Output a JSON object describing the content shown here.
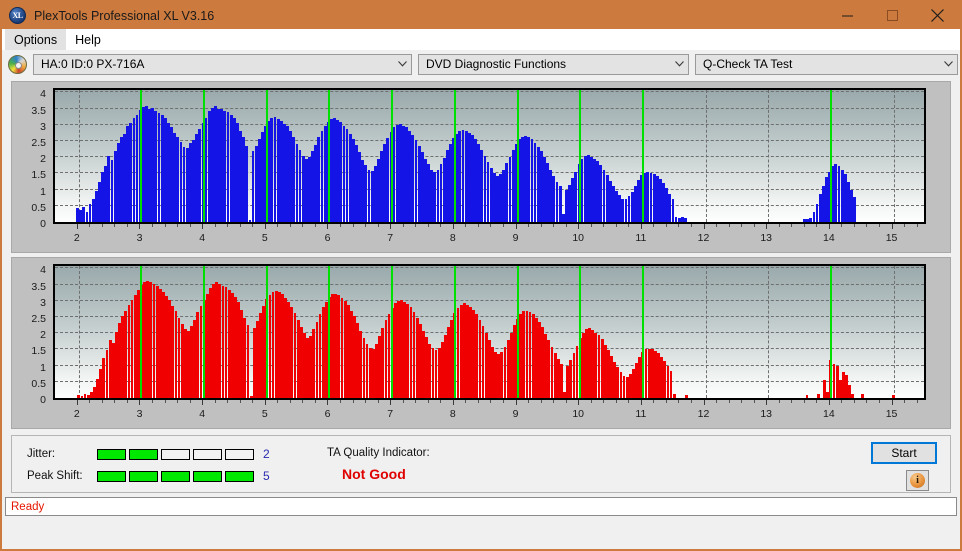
{
  "window": {
    "title": "PlexTools Professional XL V3.16",
    "app_icon": "XL",
    "minimize": "minimize-icon",
    "maximize": "maximize-icon",
    "close": "close-icon",
    "titlebar_color": "#cc7a3d"
  },
  "menubar": {
    "items": [
      {
        "label": "Options"
      },
      {
        "label": "Help"
      }
    ]
  },
  "toolbar": {
    "drive_select": "HA:0 ID:0  PX-716A",
    "function_select": "DVD Diagnostic Functions",
    "test_select": "Q-Check TA Test"
  },
  "results": {
    "jitter_label": "Jitter:",
    "jitter_value": "2",
    "jitter_filled": 2,
    "jitter_total": 5,
    "peak_shift_label": "Peak Shift:",
    "peak_shift_value": "5",
    "peak_shift_filled": 5,
    "peak_shift_total": 5,
    "ta_quality_label": "TA Quality Indicator:",
    "ta_quality_value": "Not Good",
    "ta_quality_color": "#e00000",
    "start_label": "Start",
    "info_label": "i"
  },
  "statusbar": {
    "text": "Ready",
    "color": "#e51400"
  },
  "chart_data": [
    {
      "type": "bar",
      "title": "",
      "name": "ta-test-chart-blue",
      "color": "#1414e6",
      "xlabel": "",
      "ylabel": "",
      "xlim": [
        1.62,
        15.55
      ],
      "ylim": [
        0,
        4.2
      ],
      "yticks": [
        0,
        0.5,
        1,
        1.5,
        2,
        2.5,
        3,
        3.5,
        4
      ],
      "xticks": [
        2,
        3,
        4,
        5,
        6,
        7,
        8,
        9,
        10,
        11,
        12,
        13,
        14,
        15
      ],
      "grid": true,
      "markers": [
        3,
        4,
        5,
        6,
        7,
        8,
        9,
        10,
        11,
        14
      ],
      "marker_color": "#00e000",
      "x": [
        1.98,
        2.03,
        2.08,
        2.13,
        2.18,
        2.23,
        2.28,
        2.33,
        2.38,
        2.43,
        2.48,
        2.53,
        2.58,
        2.63,
        2.68,
        2.73,
        2.78,
        2.83,
        2.88,
        2.93,
        2.98,
        3.03,
        3.08,
        3.13,
        3.18,
        3.23,
        3.28,
        3.33,
        3.38,
        3.43,
        3.48,
        3.53,
        3.58,
        3.63,
        3.68,
        3.73,
        3.78,
        3.83,
        3.88,
        3.93,
        3.98,
        4.03,
        4.08,
        4.13,
        4.18,
        4.23,
        4.28,
        4.33,
        4.38,
        4.43,
        4.48,
        4.53,
        4.58,
        4.63,
        4.68,
        4.73,
        4.78,
        4.83,
        4.88,
        4.93,
        4.98,
        5.03,
        5.08,
        5.13,
        5.18,
        5.23,
        5.28,
        5.33,
        5.38,
        5.43,
        5.48,
        5.53,
        5.58,
        5.63,
        5.68,
        5.73,
        5.78,
        5.83,
        5.88,
        5.93,
        5.98,
        6.03,
        6.08,
        6.13,
        6.18,
        6.23,
        6.28,
        6.33,
        6.38,
        6.43,
        6.48,
        6.53,
        6.58,
        6.63,
        6.68,
        6.73,
        6.78,
        6.83,
        6.88,
        6.93,
        6.98,
        7.03,
        7.08,
        7.13,
        7.18,
        7.23,
        7.28,
        7.33,
        7.38,
        7.43,
        7.48,
        7.53,
        7.58,
        7.63,
        7.68,
        7.73,
        7.78,
        7.83,
        7.88,
        7.93,
        7.98,
        8.03,
        8.08,
        8.13,
        8.18,
        8.23,
        8.28,
        8.33,
        8.38,
        8.43,
        8.48,
        8.53,
        8.58,
        8.63,
        8.68,
        8.73,
        8.78,
        8.83,
        8.88,
        8.93,
        8.98,
        9.03,
        9.08,
        9.13,
        9.18,
        9.23,
        9.28,
        9.33,
        9.38,
        9.43,
        9.48,
        9.53,
        9.58,
        9.63,
        9.68,
        9.73,
        9.78,
        9.83,
        9.88,
        9.93,
        9.98,
        10.03,
        10.08,
        10.13,
        10.18,
        10.23,
        10.28,
        10.33,
        10.38,
        10.43,
        10.48,
        10.53,
        10.58,
        10.63,
        10.68,
        10.73,
        10.78,
        10.83,
        10.88,
        10.93,
        10.98,
        11.03,
        11.08,
        11.13,
        11.18,
        11.23,
        11.28,
        11.33,
        11.38,
        11.43,
        11.48,
        11.53,
        11.58,
        11.63,
        11.68,
        13.58,
        13.63,
        13.68,
        13.73,
        13.78,
        13.83,
        13.88,
        13.93,
        13.98,
        14.03,
        14.08,
        14.13,
        14.18,
        14.23,
        14.28,
        14.33,
        14.38
      ],
      "values": [
        0.42,
        0.38,
        0.45,
        0.3,
        0.55,
        0.72,
        0.95,
        1.25,
        1.55,
        1.72,
        2.05,
        1.9,
        2.2,
        2.45,
        2.62,
        2.72,
        2.95,
        3.05,
        3.22,
        3.32,
        3.45,
        3.55,
        3.58,
        3.5,
        3.52,
        3.42,
        3.38,
        3.3,
        3.22,
        3.05,
        2.92,
        2.75,
        2.62,
        2.48,
        2.32,
        2.3,
        2.45,
        2.52,
        2.72,
        2.88,
        3.05,
        3.2,
        3.42,
        3.52,
        3.58,
        3.5,
        3.48,
        3.42,
        3.4,
        3.3,
        3.22,
        3.05,
        2.82,
        2.62,
        2.35,
        0.05,
        2.18,
        2.35,
        2.55,
        2.78,
        2.95,
        3.12,
        3.22,
        3.25,
        3.18,
        3.12,
        3.02,
        2.95,
        2.82,
        2.62,
        2.42,
        2.22,
        2.05,
        1.95,
        2.02,
        2.18,
        2.38,
        2.62,
        2.82,
        2.98,
        3.1,
        3.18,
        3.2,
        3.15,
        3.08,
        2.98,
        2.88,
        2.72,
        2.55,
        2.38,
        2.15,
        1.92,
        1.75,
        1.62,
        1.58,
        1.72,
        1.95,
        2.18,
        2.42,
        2.58,
        2.78,
        2.92,
        3.0,
        3.02,
        2.98,
        2.92,
        2.82,
        2.7,
        2.52,
        2.35,
        2.15,
        1.95,
        1.78,
        1.62,
        1.55,
        1.6,
        1.78,
        1.98,
        2.22,
        2.42,
        2.6,
        2.72,
        2.82,
        2.85,
        2.82,
        2.75,
        2.68,
        2.55,
        2.4,
        2.22,
        2.05,
        1.85,
        1.68,
        1.5,
        1.42,
        1.48,
        1.62,
        1.82,
        2.02,
        2.22,
        2.4,
        2.55,
        2.62,
        2.65,
        2.62,
        2.55,
        2.45,
        2.32,
        2.18,
        2.0,
        1.82,
        1.62,
        1.42,
        1.25,
        1.1,
        0.25,
        1.0,
        1.15,
        1.35,
        1.55,
        1.78,
        1.95,
        2.05,
        2.08,
        2.02,
        1.95,
        1.88,
        1.75,
        1.6,
        1.45,
        1.28,
        1.12,
        0.95,
        0.82,
        0.72,
        0.7,
        0.8,
        0.92,
        1.12,
        1.3,
        1.45,
        1.52,
        1.55,
        1.52,
        1.48,
        1.42,
        1.32,
        1.2,
        1.05,
        0.88,
        0.7,
        0.15,
        0.12,
        0.14,
        0.12,
        0.08,
        0.1,
        0.12,
        0.3,
        0.55,
        0.85,
        1.12,
        1.38,
        1.55,
        1.72,
        1.78,
        1.72,
        1.62,
        1.48,
        1.25,
        1.0,
        0.78
      ]
    },
    {
      "type": "bar",
      "title": "",
      "name": "ta-test-chart-red",
      "color": "#f00000",
      "xlabel": "",
      "ylabel": "",
      "xlim": [
        1.62,
        15.55
      ],
      "ylim": [
        0,
        4.2
      ],
      "yticks": [
        0,
        0.5,
        1,
        1.5,
        2,
        2.5,
        3,
        3.5,
        4
      ],
      "xticks": [
        2,
        3,
        4,
        5,
        6,
        7,
        8,
        9,
        10,
        11,
        12,
        13,
        14,
        15
      ],
      "grid": true,
      "markers": [
        3,
        4,
        5,
        6,
        7,
        8,
        9,
        10,
        11,
        14
      ],
      "marker_color": "#00e000",
      "x": [
        2.0,
        2.05,
        2.1,
        2.15,
        2.2,
        2.25,
        2.3,
        2.35,
        2.4,
        2.45,
        2.5,
        2.55,
        2.6,
        2.65,
        2.7,
        2.75,
        2.8,
        2.85,
        2.9,
        2.95,
        3.0,
        3.05,
        3.1,
        3.15,
        3.2,
        3.25,
        3.3,
        3.35,
        3.4,
        3.45,
        3.5,
        3.55,
        3.6,
        3.65,
        3.7,
        3.75,
        3.8,
        3.85,
        3.9,
        3.95,
        4.0,
        4.05,
        4.1,
        4.15,
        4.2,
        4.25,
        4.3,
        4.35,
        4.4,
        4.45,
        4.5,
        4.55,
        4.6,
        4.65,
        4.7,
        4.75,
        4.8,
        4.85,
        4.9,
        4.95,
        5.0,
        5.05,
        5.1,
        5.15,
        5.2,
        5.25,
        5.3,
        5.35,
        5.4,
        5.45,
        5.5,
        5.55,
        5.6,
        5.65,
        5.7,
        5.75,
        5.8,
        5.85,
        5.9,
        5.95,
        6.0,
        6.05,
        6.1,
        6.15,
        6.2,
        6.25,
        6.3,
        6.35,
        6.4,
        6.45,
        6.5,
        6.55,
        6.6,
        6.65,
        6.7,
        6.75,
        6.8,
        6.85,
        6.9,
        6.95,
        7.0,
        7.05,
        7.1,
        7.15,
        7.2,
        7.25,
        7.3,
        7.35,
        7.4,
        7.45,
        7.5,
        7.55,
        7.6,
        7.65,
        7.7,
        7.75,
        7.8,
        7.85,
        7.9,
        7.95,
        8.0,
        8.05,
        8.1,
        8.15,
        8.2,
        8.25,
        8.3,
        8.35,
        8.4,
        8.45,
        8.5,
        8.55,
        8.6,
        8.65,
        8.7,
        8.75,
        8.8,
        8.85,
        8.9,
        8.95,
        9.0,
        9.05,
        9.1,
        9.15,
        9.2,
        9.25,
        9.3,
        9.35,
        9.4,
        9.45,
        9.5,
        9.55,
        9.6,
        9.65,
        9.7,
        9.75,
        9.8,
        9.85,
        9.9,
        9.95,
        10.0,
        10.05,
        10.1,
        10.15,
        10.2,
        10.25,
        10.3,
        10.35,
        10.4,
        10.45,
        10.5,
        10.55,
        10.6,
        10.65,
        10.7,
        10.75,
        10.8,
        10.85,
        10.9,
        10.95,
        11.0,
        11.05,
        11.1,
        11.15,
        11.2,
        11.25,
        11.3,
        11.35,
        11.4,
        11.45,
        11.5,
        11.7,
        13.62,
        13.8,
        13.9,
        13.95,
        14.0,
        14.05,
        14.1,
        14.15,
        14.2,
        14.25,
        14.3,
        14.35,
        14.5,
        15.0
      ],
      "values": [
        0.1,
        0.05,
        0.12,
        0.1,
        0.18,
        0.35,
        0.58,
        0.9,
        1.25,
        1.48,
        1.78,
        1.7,
        2.05,
        2.32,
        2.52,
        2.68,
        2.88,
        3.02,
        3.18,
        3.35,
        3.48,
        3.58,
        3.62,
        3.58,
        3.52,
        3.45,
        3.38,
        3.28,
        3.15,
        3.02,
        2.85,
        2.68,
        2.48,
        2.28,
        2.12,
        2.08,
        2.22,
        2.42,
        2.65,
        2.85,
        3.02,
        3.22,
        3.4,
        3.52,
        3.58,
        3.52,
        3.45,
        3.42,
        3.35,
        3.25,
        3.12,
        2.95,
        2.72,
        2.48,
        2.25,
        0.05,
        2.15,
        2.38,
        2.62,
        2.85,
        3.05,
        3.18,
        3.28,
        3.32,
        3.28,
        3.2,
        3.1,
        2.98,
        2.82,
        2.62,
        2.42,
        2.2,
        2.0,
        1.85,
        1.92,
        2.12,
        2.35,
        2.58,
        2.8,
        2.98,
        3.12,
        3.2,
        3.22,
        3.18,
        3.1,
        3.0,
        2.88,
        2.7,
        2.52,
        2.32,
        2.08,
        1.85,
        1.68,
        1.55,
        1.52,
        1.68,
        1.9,
        2.15,
        2.4,
        2.58,
        2.78,
        2.92,
        3.0,
        3.02,
        2.98,
        2.9,
        2.8,
        2.65,
        2.48,
        2.28,
        2.08,
        1.88,
        1.68,
        1.55,
        1.48,
        1.55,
        1.72,
        1.95,
        2.2,
        2.42,
        2.62,
        2.78,
        2.88,
        2.92,
        2.88,
        2.82,
        2.72,
        2.58,
        2.42,
        2.22,
        2.0,
        1.8,
        1.58,
        1.42,
        1.35,
        1.42,
        1.58,
        1.8,
        2.02,
        2.25,
        2.45,
        2.6,
        2.68,
        2.7,
        2.65,
        2.58,
        2.48,
        2.35,
        2.18,
        1.98,
        1.78,
        1.58,
        1.38,
        1.2,
        1.05,
        0.2,
        1.0,
        1.18,
        1.4,
        1.62,
        1.85,
        2.02,
        2.12,
        2.15,
        2.1,
        2.02,
        1.95,
        1.82,
        1.65,
        1.48,
        1.3,
        1.12,
        0.95,
        0.8,
        0.68,
        0.65,
        0.75,
        0.9,
        1.08,
        1.28,
        1.42,
        1.5,
        1.52,
        1.5,
        1.45,
        1.38,
        1.28,
        1.15,
        1.0,
        0.82,
        0.12,
        0.1,
        0.1,
        0.12,
        0.55,
        0.2,
        1.18,
        1.05,
        1.0,
        0.55,
        0.8,
        0.72,
        0.4,
        0.12,
        0.12,
        0.1
      ]
    }
  ]
}
